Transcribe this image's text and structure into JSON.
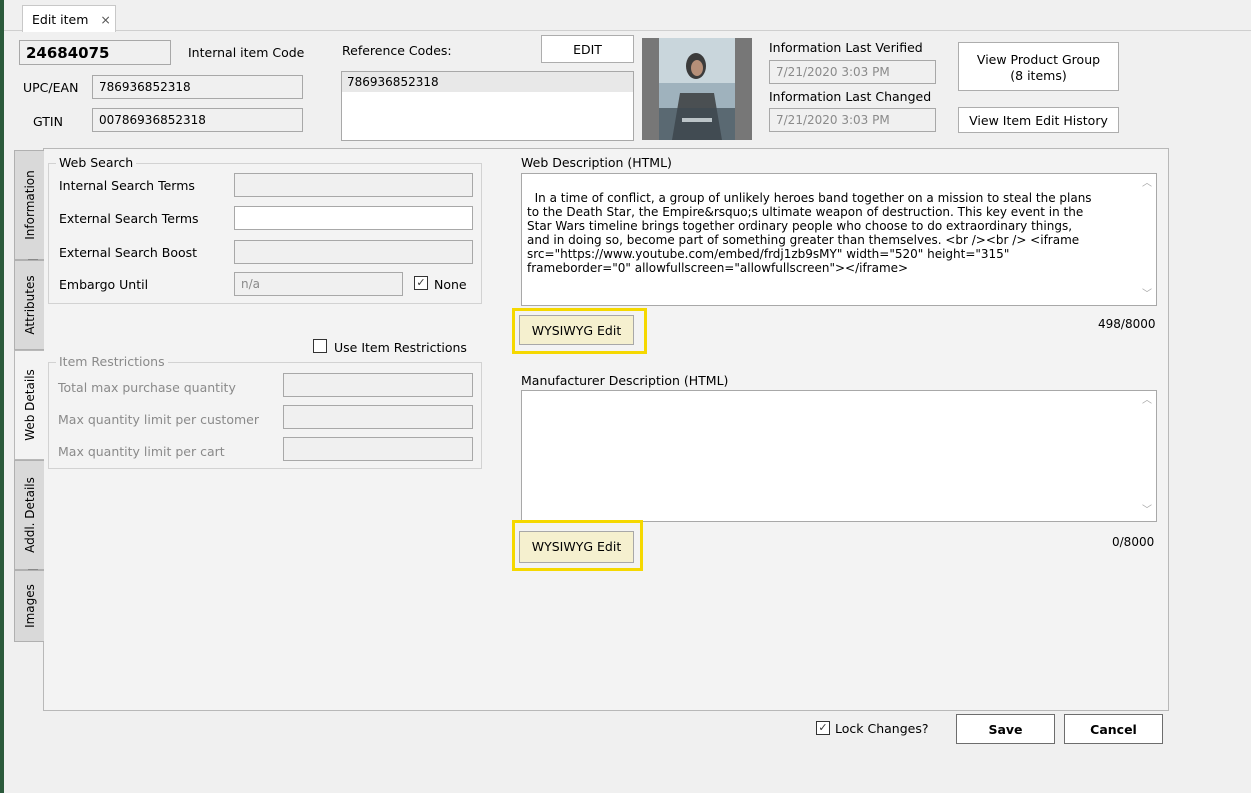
{
  "tab": {
    "title": "Edit item",
    "close_glyph": "×"
  },
  "header": {
    "item_code_value": "24684075",
    "internal_item_code_label": "Internal item Code",
    "upc_label": "UPC/EAN",
    "upc_value": "786936852318",
    "gtin_label": "GTIN",
    "gtin_value": "00786936852318",
    "reference_codes_label": "Reference Codes:",
    "reference_codes": [
      "786936852318"
    ],
    "edit_button": "EDIT",
    "info_verified_label": "Information Last Verified",
    "info_verified_value": "7/21/2020 3:03 PM",
    "info_changed_label": "Information Last Changed",
    "info_changed_value": "7/21/2020 3:03 PM",
    "view_product_group_line1": "View Product Group",
    "view_product_group_line2": "(8 items)",
    "view_edit_history": "View Item Edit History"
  },
  "side_tabs": [
    "Information",
    "Attributes",
    "Web Details",
    "Addl. Details",
    "Images"
  ],
  "active_side_tab": "Web Details",
  "web_search": {
    "title": "Web Search",
    "internal_terms_label": "Internal Search Terms",
    "internal_terms_value": "",
    "external_terms_label": "External Search Terms",
    "external_terms_value": "",
    "external_boost_label": "External Search Boost",
    "external_boost_value": "",
    "embargo_label": "Embargo Until",
    "embargo_value": "n/a",
    "none_label": "None",
    "none_checked": true
  },
  "restrictions": {
    "use_label": "Use Item Restrictions",
    "use_checked": false,
    "title": "Item Restrictions",
    "total_max_label": "Total max purchase quantity",
    "per_customer_label": "Max quantity limit per customer",
    "per_cart_label": "Max quantity limit per cart"
  },
  "web_description": {
    "label": "Web Description (HTML)",
    "text": "In a time of conflict, a group of unlikely heroes band together on a mission to steal the plans\nto the Death Star, the Empire&rsquo;s ultimate weapon of destruction. This key event in the\nStar Wars timeline brings together ordinary people who choose to do extraordinary things,\nand in doing so, become part of something greater than themselves. <br /><br /> <iframe\nsrc=\"https://www.youtube.com/embed/frdj1zb9sMY\" width=\"520\" height=\"315\"\nframeborder=\"0\" allowfullscreen=\"allowfullscreen\"></iframe>",
    "wysiwyg_button": "WYSIWYG Edit",
    "count": "498/8000"
  },
  "manufacturer_description": {
    "label": "Manufacturer Description (HTML)",
    "text": "",
    "wysiwyg_button": "WYSIWYG Edit",
    "count": "0/8000"
  },
  "footer": {
    "lock_label": "Lock Changes?",
    "lock_checked": true,
    "save_button": "Save",
    "cancel_button": "Cancel"
  },
  "icons": {
    "checkmark": "✓",
    "scroll_up": "︿",
    "scroll_down": "﹀"
  },
  "colors": {
    "highlight": "#f5d800",
    "wysiwyg_bg": "#f5f0cf"
  }
}
